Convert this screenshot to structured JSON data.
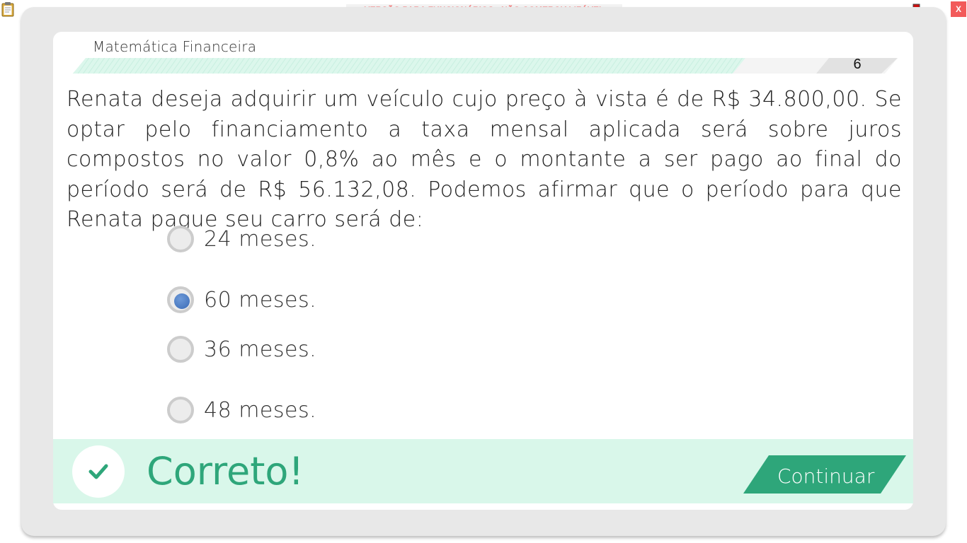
{
  "watermark": "VERSÃO PARA FUNCIONÁRIOS - NÃO COMERCIALIZÁVEL",
  "close_label": "X",
  "subject": "Matemática Financeira",
  "page_number": "6",
  "question": "Renata deseja adquirir um veículo cujo preço à vista é de R$ 34.800,00. Se optar pelo financiamento a taxa mensal aplicada será sobre juros compostos no valor 0,8% ao mês e o montante a ser pago ao final do período será de R$ 56.132,08. Podemos afirmar que o período para que Renata pague seu carro será de:",
  "options": [
    {
      "label": "24 meses.",
      "selected": false
    },
    {
      "label": "60 meses.",
      "selected": true
    },
    {
      "label": "36 meses.",
      "selected": false
    },
    {
      "label": "48 meses.",
      "selected": false
    }
  ],
  "feedback": {
    "text": "Correto!",
    "continue_label": "Continuar"
  },
  "colors": {
    "accent_green": "#2ea67a",
    "feedback_bg": "#d9f7ea",
    "selected_radio": "#3a6bb6",
    "watermark_red": "#f25a5a"
  },
  "icons": [
    "clipboard-icon",
    "network-status-icon",
    "check-icon"
  ]
}
